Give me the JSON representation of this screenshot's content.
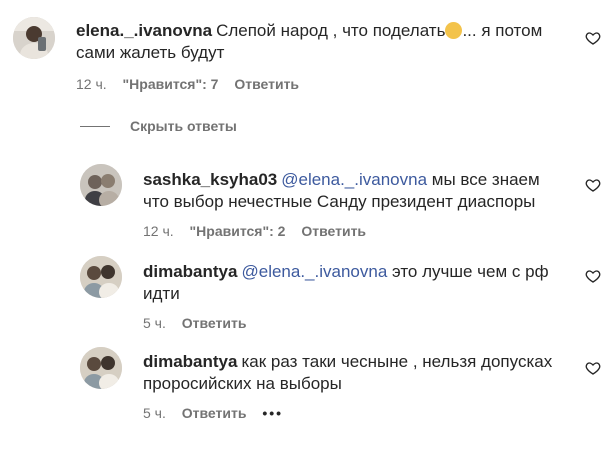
{
  "comments": [
    {
      "username": "elena._.ivanovna",
      "text_before": "Слепой народ , что поделать",
      "emoji": "disappointed-face-emoji",
      "text_after": "... я потом сами жалеть будут",
      "time": "12 ч.",
      "likes": "\"Нравится\": 7",
      "reply": "Ответить"
    }
  ],
  "hide_replies": "Скрыть ответы",
  "replies": [
    {
      "username": "sashka_ksyha03",
      "mention": "@elena._.ivanovna",
      "text": " мы все знаем что выбор нечестные Санду президент диаспоры",
      "time": "12 ч.",
      "likes": "\"Нравится\": 2",
      "reply": "Ответить"
    },
    {
      "username": "dimabantya",
      "mention": "@elena._.ivanovna",
      "text": " это лучше чем с рф идти",
      "time": "5 ч.",
      "reply": "Ответить"
    },
    {
      "username": "dimabantya",
      "text": "как раз таки чесныне , нельзя допускаx проросийских на выборы",
      "time": "5 ч.",
      "reply": "Ответить",
      "more": "•••"
    }
  ],
  "icons": {
    "heart": "heart-outline-icon",
    "avatar": "user-avatar-photo"
  },
  "colors": {
    "text": "#262626",
    "meta": "#737373",
    "mention": "#3d5a9e"
  }
}
